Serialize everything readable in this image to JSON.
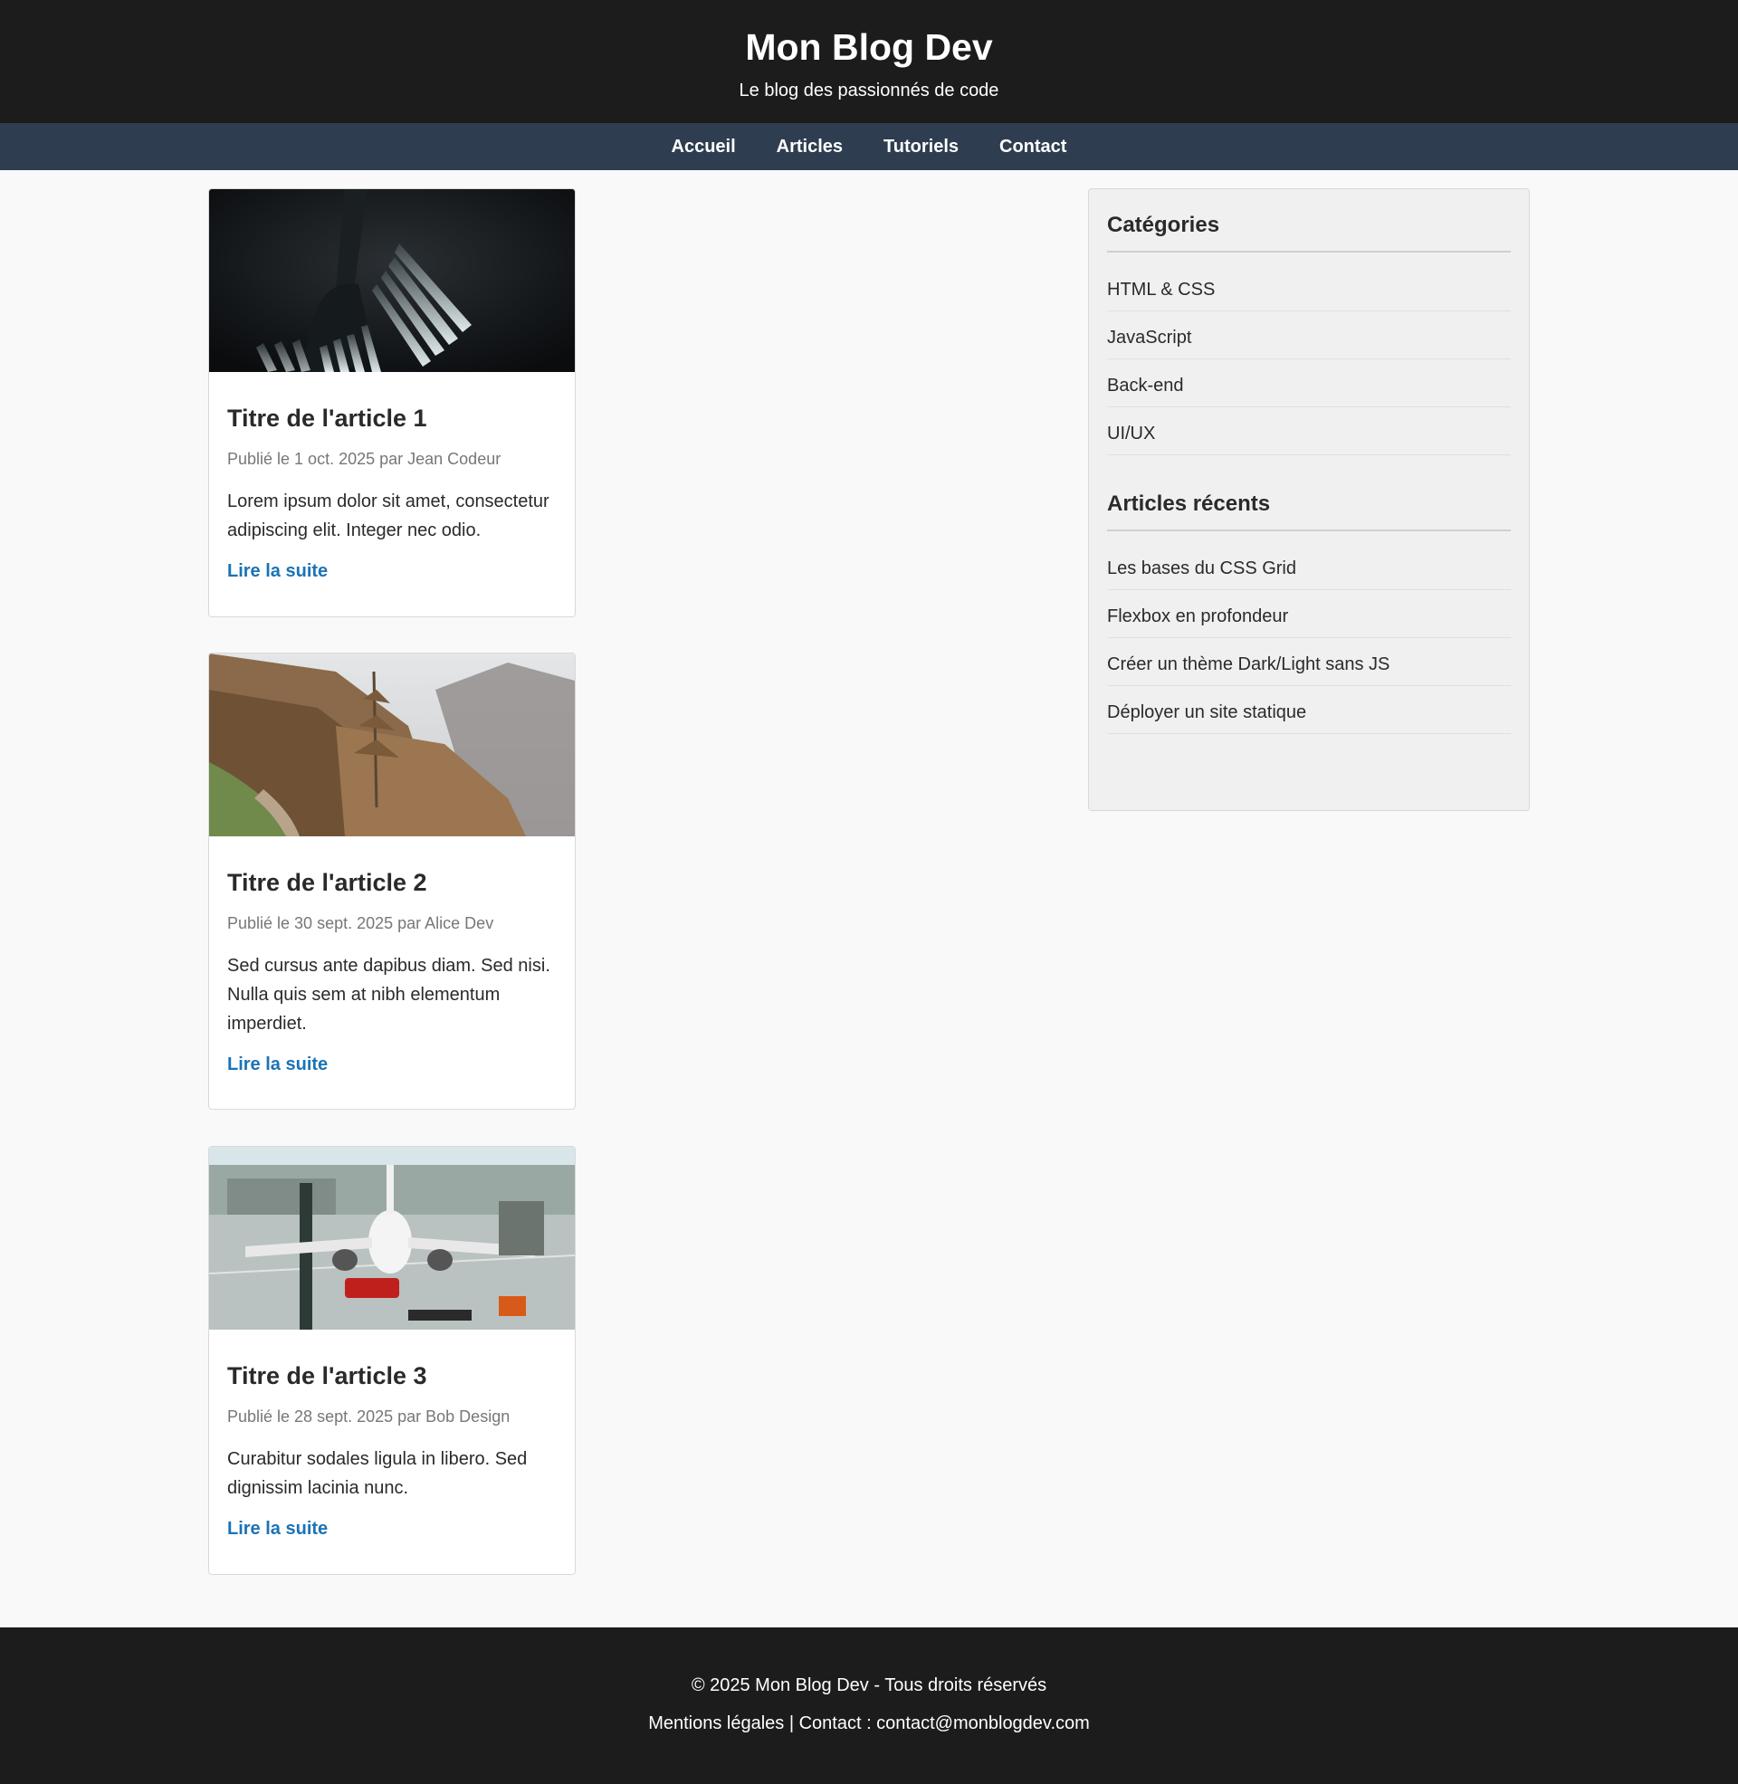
{
  "header": {
    "title": "Mon Blog Dev",
    "tagline": "Le blog des passionnés de code"
  },
  "nav": {
    "items": [
      "Accueil",
      "Articles",
      "Tutoriels",
      "Contact"
    ]
  },
  "articles": [
    {
      "image": "forks-photo",
      "title": "Titre de l'article 1",
      "meta": "Publié le 1 oct. 2025 par Jean Codeur",
      "excerpt": "Lorem ipsum dolor sit amet, consectetur adipiscing elit. Integer nec odio.",
      "link": "Lire la suite"
    },
    {
      "image": "misty-forest-photo",
      "title": "Titre de l'article 2",
      "meta": "Publié le 30 sept. 2025 par Alice Dev",
      "excerpt": "Sed cursus ante dapibus diam. Sed nisi. Nulla quis sem at nibh elementum imperdiet.",
      "link": "Lire la suite"
    },
    {
      "image": "airplane-photo",
      "title": "Titre de l'article 3",
      "meta": "Publié le 28 sept. 2025 par Bob Design",
      "excerpt": "Curabitur sodales ligula in libero. Sed dignissim lacinia nunc.",
      "link": "Lire la suite"
    }
  ],
  "sidebar": {
    "categories": {
      "title": "Catégories",
      "items": [
        "HTML & CSS",
        "JavaScript",
        "Back-end",
        "UI/UX"
      ]
    },
    "recent": {
      "title": "Articles récents",
      "items": [
        "Les bases du CSS Grid",
        "Flexbox en profondeur",
        "Créer un thème Dark/Light sans JS",
        "Déployer un site statique"
      ]
    }
  },
  "footer": {
    "copyright": "© 2025 Mon Blog Dev - Tous droits réservés",
    "legal": "Mentions légales | Contact : contact@monblogdev.com"
  },
  "colors": {
    "header_bg": "#1c1c1c",
    "nav_bg": "#2e3e50",
    "link": "#1a73b5",
    "page_bg": "#f9f9f9"
  }
}
